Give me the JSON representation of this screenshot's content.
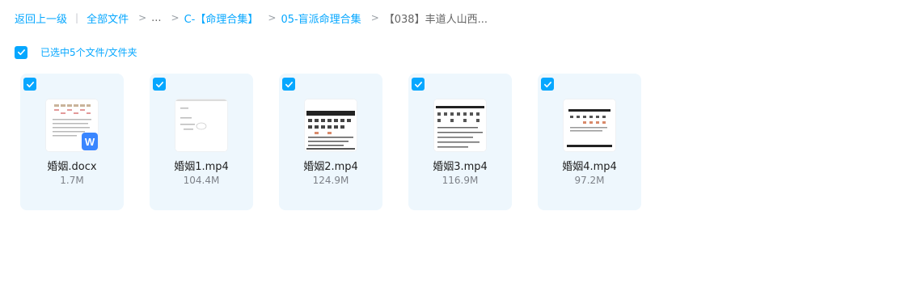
{
  "breadcrumb": {
    "back": "返回上一级",
    "separator": "|",
    "all_files": "全部文件",
    "ellipsis": "...",
    "folder1": "C-【命理合集】",
    "folder2": "05-盲派命理合集",
    "current": "【038】丰道人山西..."
  },
  "selection": {
    "label": "已选中5个文件/文件夹"
  },
  "files": [
    {
      "name": "婚姻.docx",
      "size": "1.7M",
      "icon": "word-doc-icon",
      "badge": "W"
    },
    {
      "name": "婚姻1.mp4",
      "size": "104.4M",
      "icon": "video-thumbnail"
    },
    {
      "name": "婚姻2.mp4",
      "size": "124.9M",
      "icon": "video-thumbnail"
    },
    {
      "name": "婚姻3.mp4",
      "size": "116.9M",
      "icon": "video-thumbnail"
    },
    {
      "name": "婚姻4.mp4",
      "size": "97.2M",
      "icon": "video-thumbnail"
    }
  ],
  "colors": {
    "accent": "#06a7ff",
    "card_bg": "#eef7fd",
    "word_badge": "#3a86ff"
  }
}
